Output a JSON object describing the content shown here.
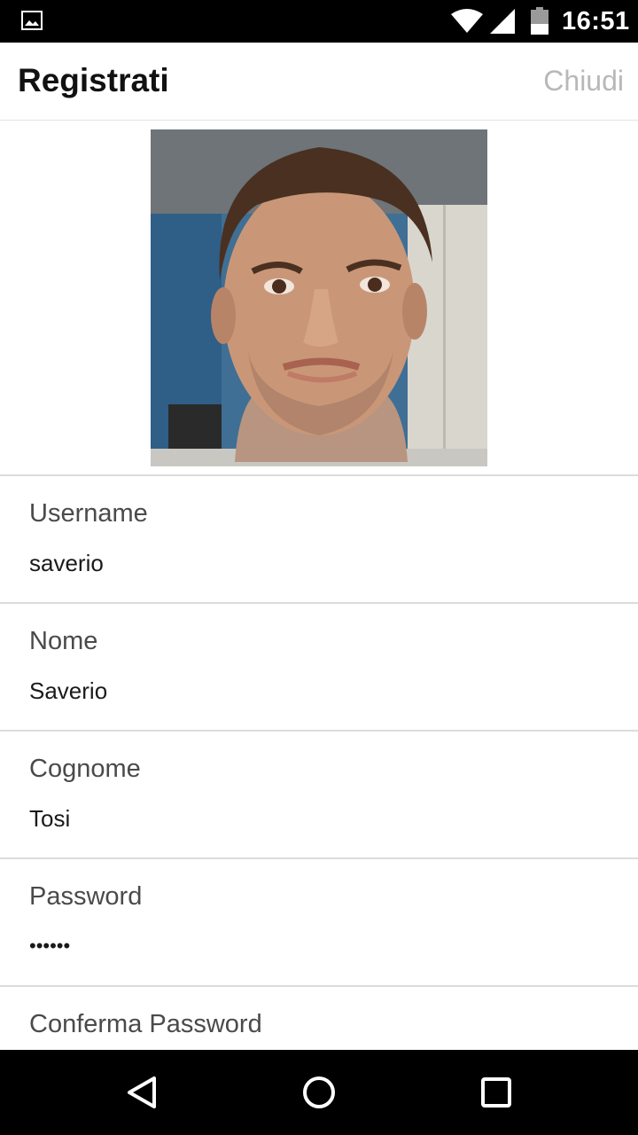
{
  "status_bar": {
    "time": "16:51",
    "icons": [
      "gallery-icon",
      "wifi-icon",
      "signal-icon",
      "battery-icon"
    ]
  },
  "header": {
    "title": "Registrati",
    "close_label": "Chiudi"
  },
  "profile": {
    "photo": "avatar-photo"
  },
  "form": {
    "fields": [
      {
        "label": "Username",
        "value": "saverio"
      },
      {
        "label": "Nome",
        "value": "Saverio"
      },
      {
        "label": "Cognome",
        "value": "Tosi"
      },
      {
        "label": "Password",
        "value": "••••••"
      },
      {
        "label": "Conferma Password",
        "value": ""
      }
    ]
  },
  "nav_bar": {
    "icons": [
      "back-icon",
      "home-icon",
      "recents-icon"
    ]
  },
  "colors": {
    "status_bar_bg": "#000000",
    "nav_bar_bg": "#000000",
    "title": "#111111",
    "close_link": "#b8b8b8",
    "label": "#4a4a4a",
    "value": "#1a1a1a",
    "divider": "#dcdcdc"
  }
}
